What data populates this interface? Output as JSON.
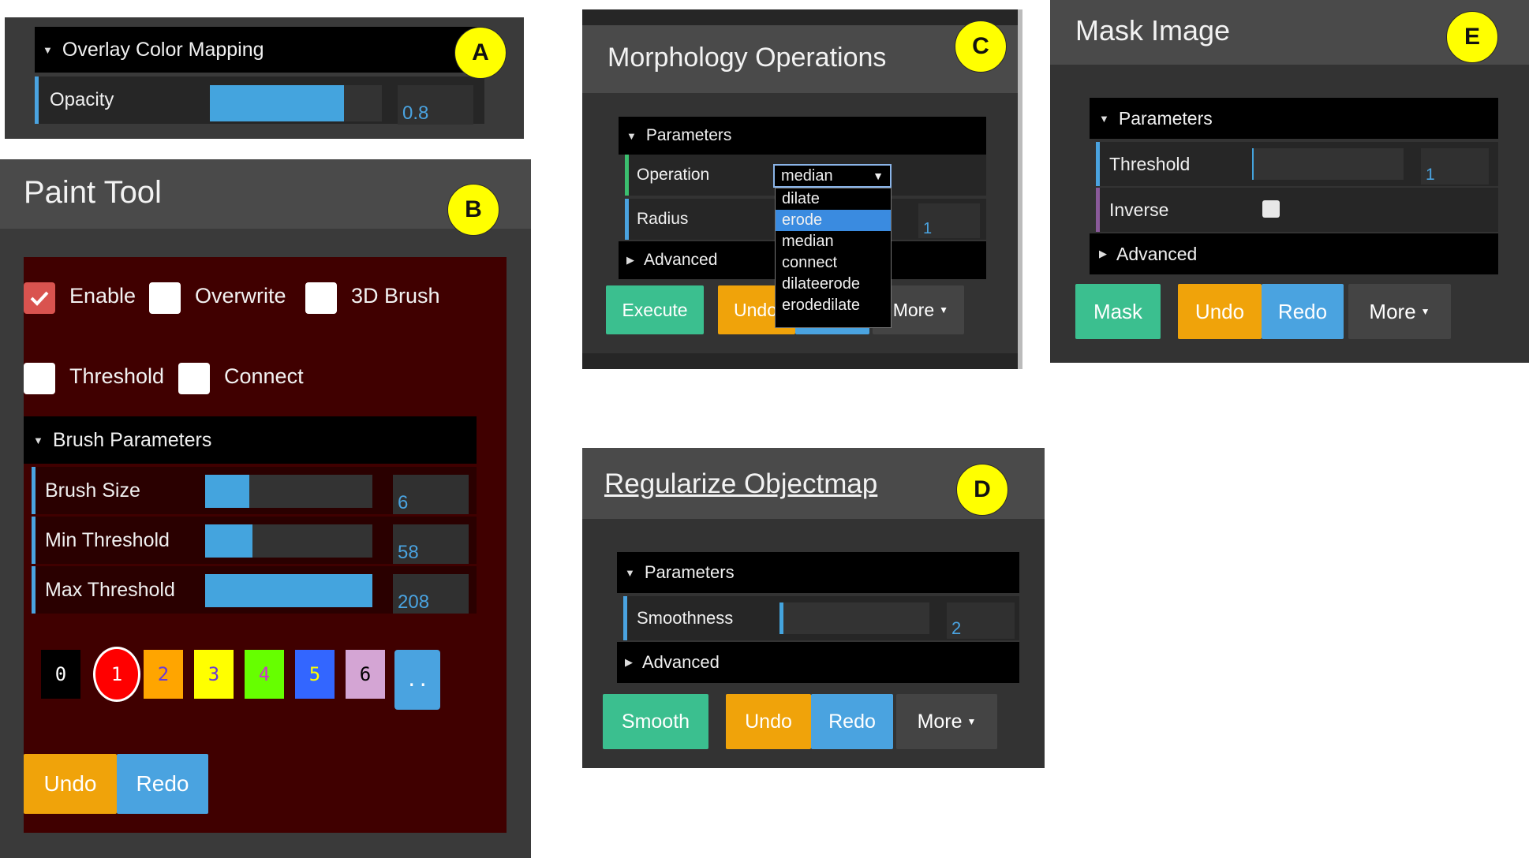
{
  "panelA": {
    "badge": "A",
    "section_title": "Overlay Color Mapping",
    "opacity": {
      "label": "Opacity",
      "value": "0.8",
      "fraction": 0.8
    }
  },
  "panelB": {
    "badge": "B",
    "title": "Paint Tool",
    "checkboxes": {
      "enable": {
        "label": "Enable",
        "checked": true
      },
      "overwrite": {
        "label": "Overwrite",
        "checked": false
      },
      "brush3d": {
        "label": "3D Brush",
        "checked": false
      },
      "threshold": {
        "label": "Threshold",
        "checked": false
      },
      "connect": {
        "label": "Connect",
        "checked": false
      }
    },
    "section_title": "Brush Parameters",
    "params": [
      {
        "label": "Brush Size",
        "value": "6"
      },
      {
        "label": "Min Threshold",
        "value": "58"
      },
      {
        "label": "Max Threshold",
        "value": "208"
      }
    ],
    "labels": [
      "0",
      "1",
      "2",
      "3",
      "4",
      "5",
      "6",
      ".."
    ],
    "label_colors": [
      "#000000",
      "#ff0000",
      "#ffa500",
      "#ffff00",
      "#66ff00",
      "#3366ff",
      "#d4a5d4",
      "#4aa3e0"
    ],
    "undo": "Undo",
    "redo": "Redo"
  },
  "panelC": {
    "badge": "C",
    "title": "Morphology Operations",
    "section_params": "Parameters",
    "operation_label": "Operation",
    "operation_value": "median",
    "radius_label": "Radius",
    "radius_value": "1",
    "options": [
      "dilate",
      "erode",
      "median",
      "connect",
      "dilateerode",
      "erodedilate"
    ],
    "highlighted_option": "erode",
    "section_advanced": "Advanced",
    "execute": "Execute",
    "undo": "Undo",
    "more": "More"
  },
  "panelD": {
    "badge": "D",
    "title": "Regularize Objectmap",
    "section_params": "Parameters",
    "smooth_label": "Smoothness",
    "smooth_value": "2",
    "section_advanced": "Advanced",
    "smooth": "Smooth",
    "undo": "Undo",
    "redo": "Redo",
    "more": "More"
  },
  "panelE": {
    "badge": "E",
    "title": "Mask Image",
    "section_params": "Parameters",
    "threshold_label": "Threshold",
    "threshold_value": "1",
    "inverse_label": "Inverse",
    "section_advanced": "Advanced",
    "mask": "Mask",
    "undo": "Undo",
    "redo": "Redo",
    "more": "More"
  }
}
